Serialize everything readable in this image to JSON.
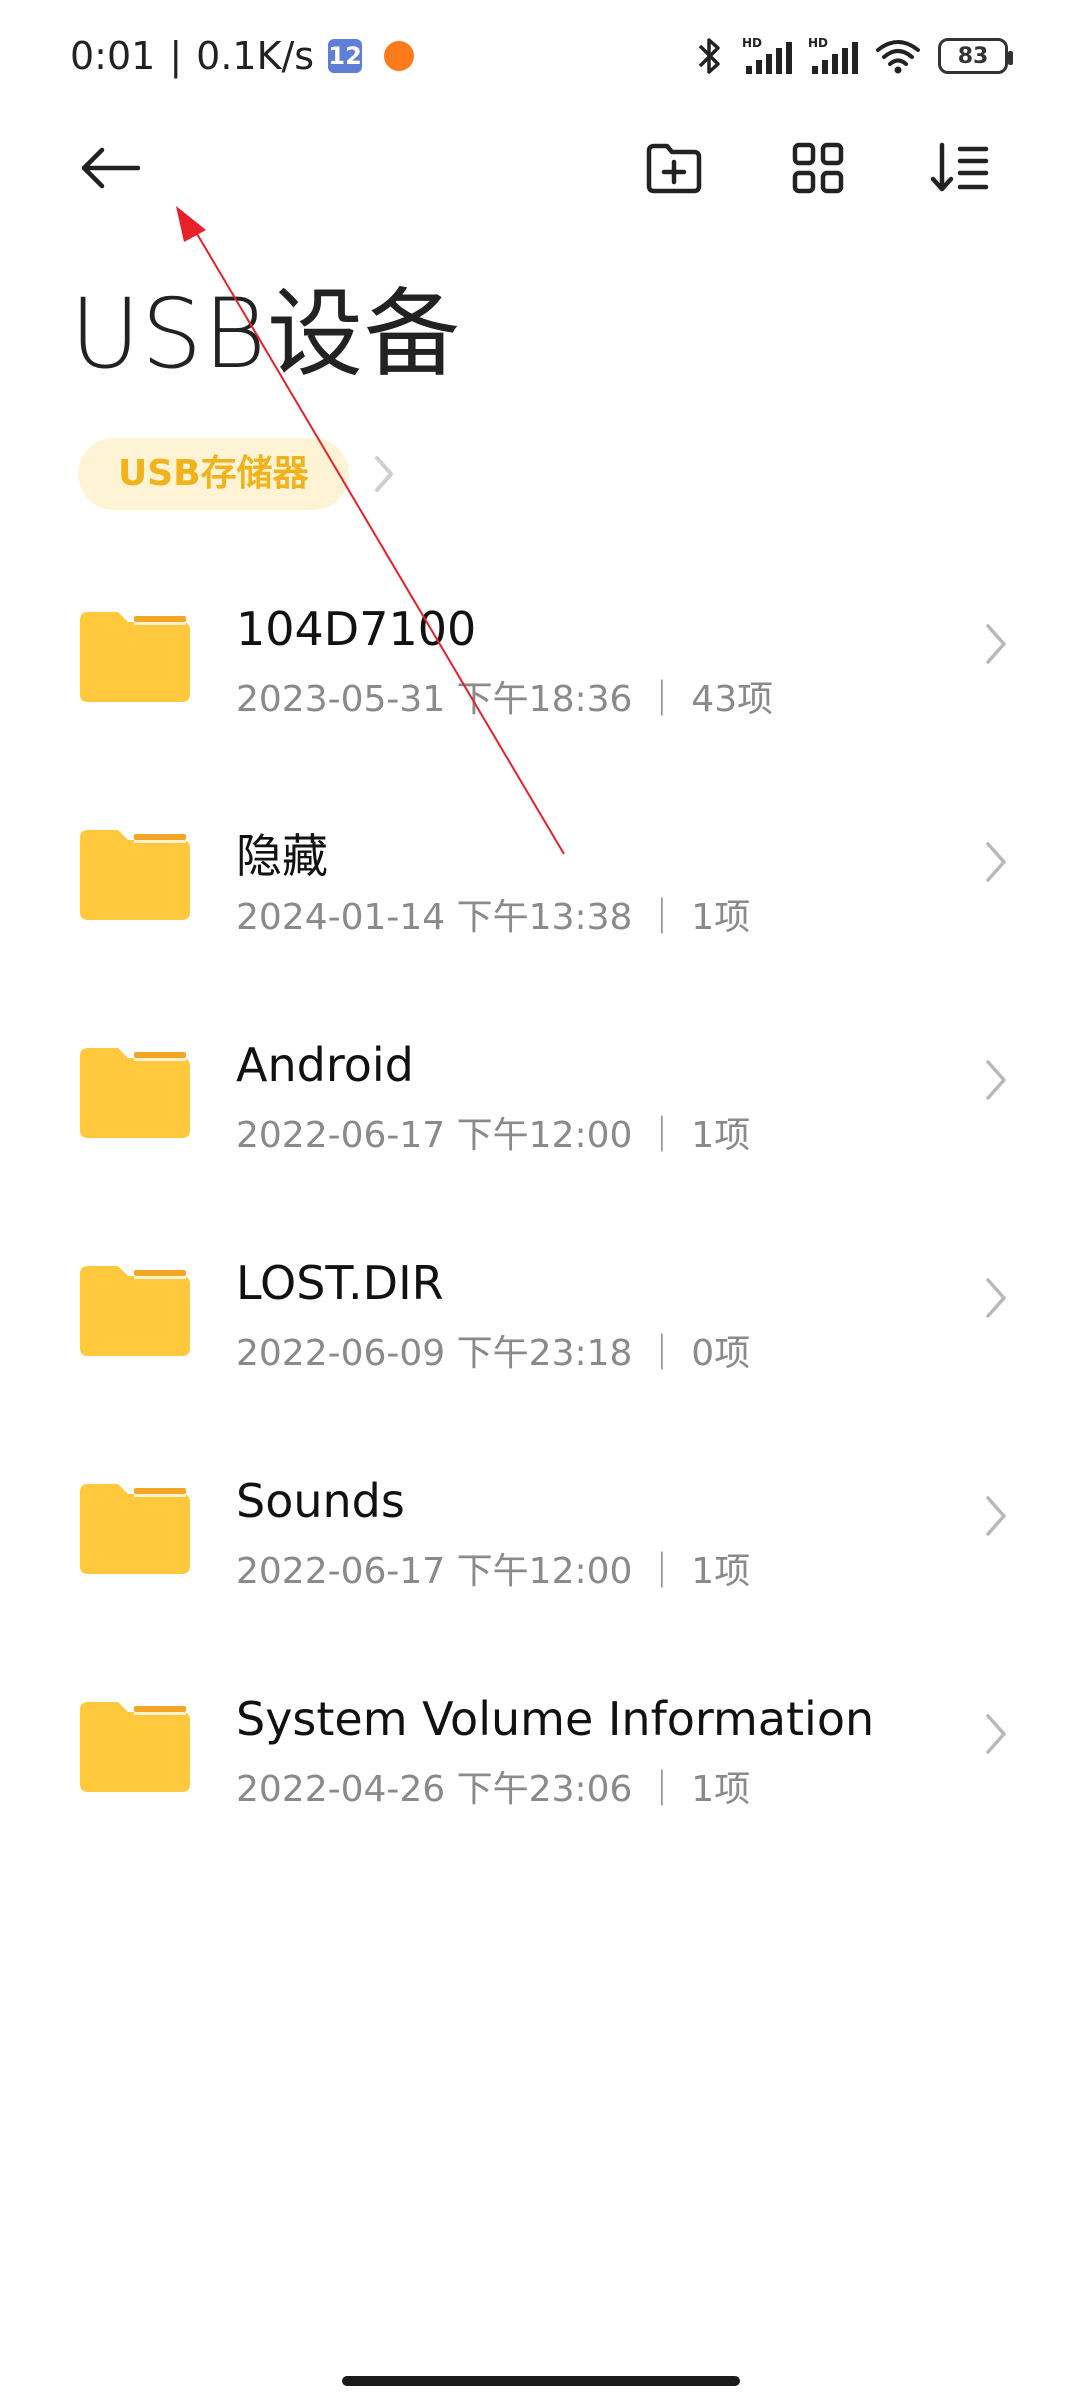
{
  "status_bar": {
    "time": "0:01",
    "separator": "|",
    "net_speed": "0.1K/s",
    "badge": "12",
    "battery": "83",
    "icons": [
      "bluetooth-icon",
      "signal-hd-icon",
      "signal-hd-icon",
      "wifi-icon",
      "battery-icon"
    ]
  },
  "toolbar": {
    "back_icon": "back-arrow-icon",
    "new_folder_icon": "new-folder-icon",
    "grid_view_icon": "grid-view-icon",
    "sort_icon": "sort-icon"
  },
  "title": "USB设备",
  "breadcrumb": {
    "current": "USB存储器"
  },
  "colors": {
    "folder": "#ffc83d",
    "folder_tab": "#f5a524",
    "chip_bg": "#fff3d6",
    "chip_text": "#f0b31b",
    "meta_text": "#8a8a8a",
    "annotation_arrow": "#e8202a"
  },
  "files": [
    {
      "name": "104D7100",
      "meta": "2023-05-31 下午18:36 ｜ 43项"
    },
    {
      "name": "隐藏",
      "meta": "2024-01-14 下午13:38 ｜ 1项"
    },
    {
      "name": "Android",
      "meta": "2022-06-17 下午12:00 ｜ 1项"
    },
    {
      "name": "LOST.DIR",
      "meta": "2022-06-09 下午23:18 ｜ 0项"
    },
    {
      "name": "Sounds",
      "meta": "2022-06-17 下午12:00 ｜ 1项"
    },
    {
      "name": "System Volume Information",
      "meta": "2022-04-26 下午23:06 ｜ 1项"
    }
  ]
}
